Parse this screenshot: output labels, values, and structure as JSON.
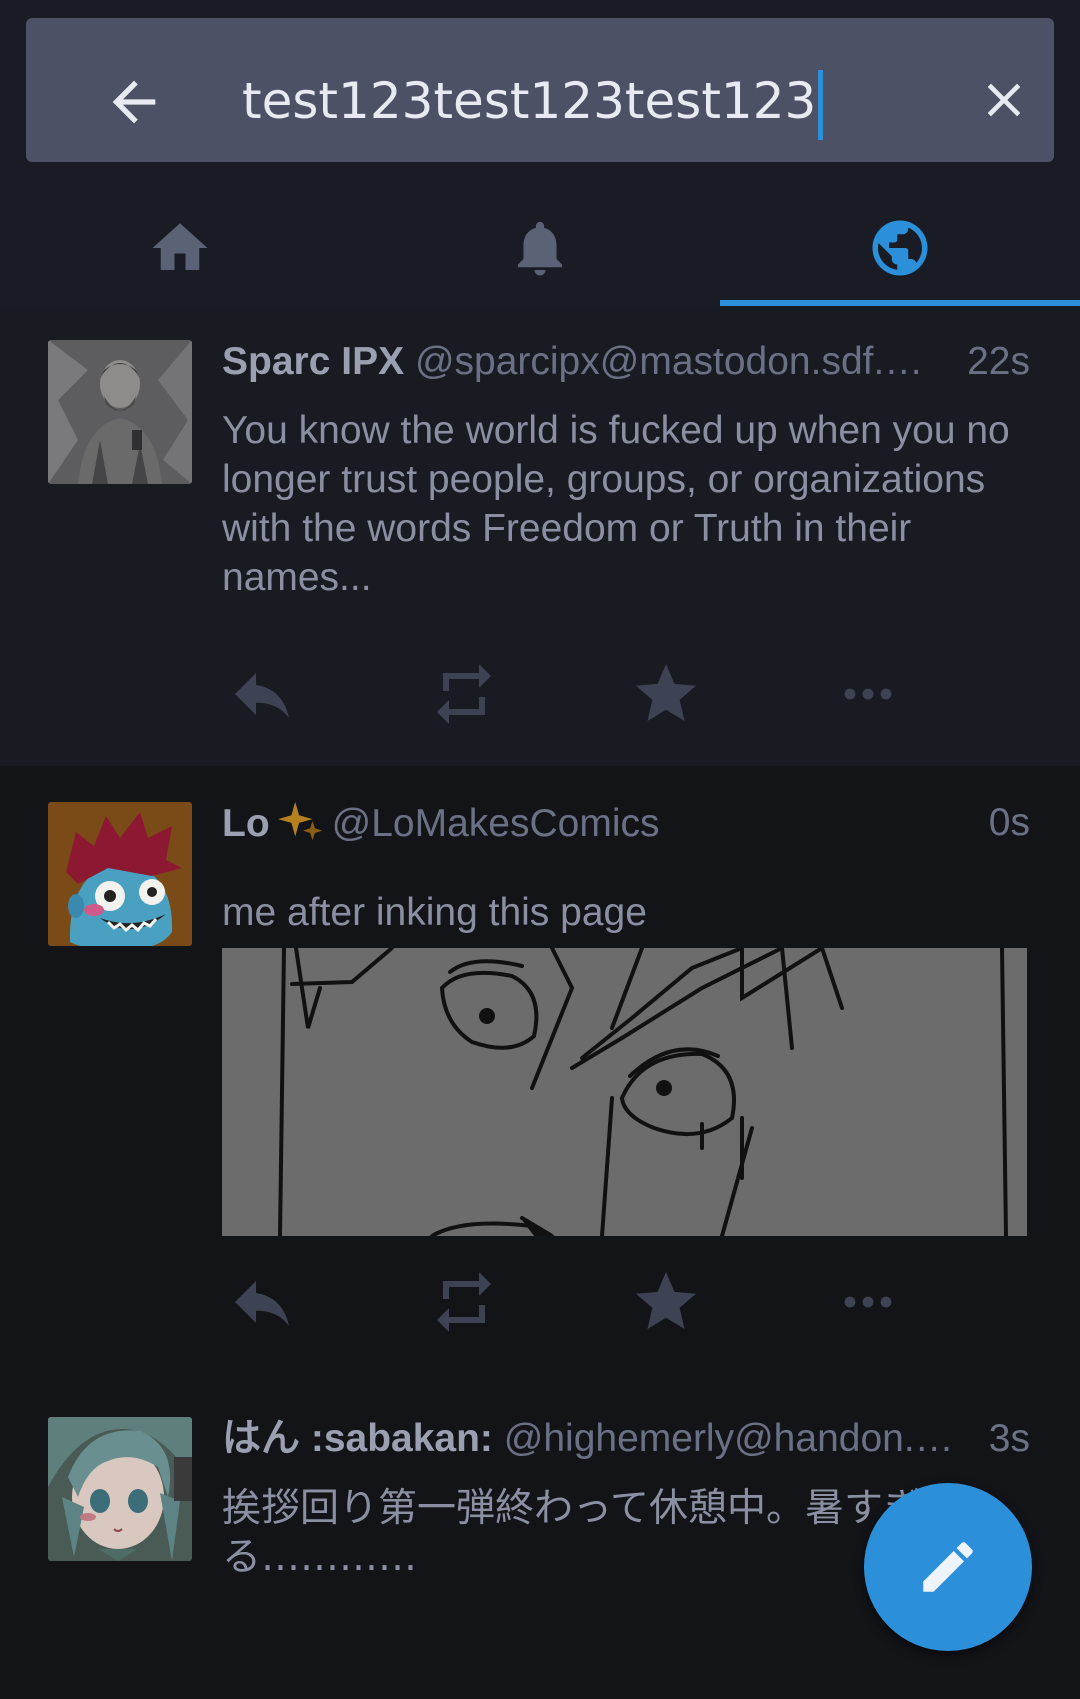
{
  "search": {
    "query": "test123test123test123",
    "back_icon": "arrow-left-icon",
    "clear_icon": "close-icon"
  },
  "tabs": [
    {
      "name": "home",
      "icon": "home-icon",
      "active": false
    },
    {
      "name": "notifications",
      "icon": "bell-icon",
      "active": false
    },
    {
      "name": "federated",
      "icon": "globe-icon",
      "active": true
    }
  ],
  "colors": {
    "accent": "#2b90d9",
    "search_bg": "#4c5166",
    "background": "#121418",
    "action_icon": "#3e4353"
  },
  "statuses": [
    {
      "display_name": "Sparc IPX",
      "acct": "@sparcipx@mastodon.sdf.…",
      "time": "22s",
      "content": "You know the world is fucked up when you no longer trust people, groups, or organizations with the words Freedom or Truth in their names..."
    },
    {
      "display_name": "Lo",
      "emoji": "sparkles-icon",
      "acct": "@LoMakesComics",
      "time": "0s",
      "content": "me after inking this page",
      "has_media": true
    },
    {
      "display_name": "はん :sabakan:",
      "acct": "@highemerly@handon.…",
      "time": "3s",
      "content": "挨拶回り第一弾終わって休憩中。暑すぎる…………"
    }
  ],
  "actions": [
    "reply-icon",
    "boost-icon",
    "favourite-icon",
    "more-icon"
  ],
  "fab": {
    "icon": "pencil-icon"
  }
}
